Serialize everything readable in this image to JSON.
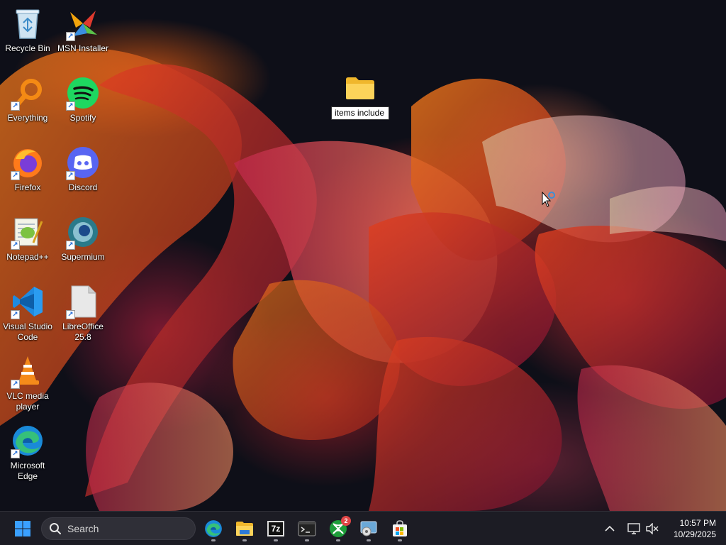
{
  "desktop": {
    "icons": [
      {
        "label": "Recycle Bin",
        "icon": "recycle-bin-icon"
      },
      {
        "label": "MSN Installer",
        "icon": "msn-icon"
      },
      {
        "label": "Everything",
        "icon": "everything-search-icon"
      },
      {
        "label": "Spotify",
        "icon": "spotify-icon"
      },
      {
        "label": "Firefox",
        "icon": "firefox-icon"
      },
      {
        "label": "Discord",
        "icon": "discord-icon"
      },
      {
        "label": "Notepad++",
        "icon": "notepadpp-icon"
      },
      {
        "label": "Supermium",
        "icon": "supermium-icon"
      },
      {
        "label": "Visual Studio Code",
        "icon": "vscode-icon"
      },
      {
        "label": "LibreOffice 25.8",
        "icon": "libreoffice-icon"
      },
      {
        "label": "VLC media player",
        "icon": "vlc-icon"
      },
      {
        "label": "Microsoft Edge",
        "icon": "edge-icon"
      }
    ],
    "rename_folder": {
      "icon": "folder-icon",
      "editing_value": "items include"
    }
  },
  "taskbar": {
    "start_icon": "windows-start-icon",
    "search_label": "Search",
    "pinned": [
      {
        "name": "Microsoft Edge",
        "icon": "edge-icon",
        "running": true
      },
      {
        "name": "File Explorer",
        "icon": "file-explorer-icon",
        "running": true
      },
      {
        "name": "7-Zip",
        "icon": "7zip-icon",
        "label": "7z",
        "running": true
      },
      {
        "name": "Terminal",
        "icon": "terminal-icon",
        "running": true
      },
      {
        "name": "Xbox",
        "icon": "xbox-icon",
        "badge": "2",
        "running": true
      },
      {
        "name": "Disk utility",
        "icon": "disk-utility-icon",
        "running": true
      },
      {
        "name": "Microsoft Store",
        "icon": "store-icon",
        "running": true
      }
    ],
    "tray": {
      "chevron_icon": "chevron-up-icon",
      "network_icon": "network-icon",
      "volume_icon": "volume-muted-icon",
      "time": "10:57 PM",
      "date": "10/29/2025"
    }
  },
  "colors": {
    "taskbar_bg": "#1c1c24",
    "accent": "#0078d4"
  }
}
